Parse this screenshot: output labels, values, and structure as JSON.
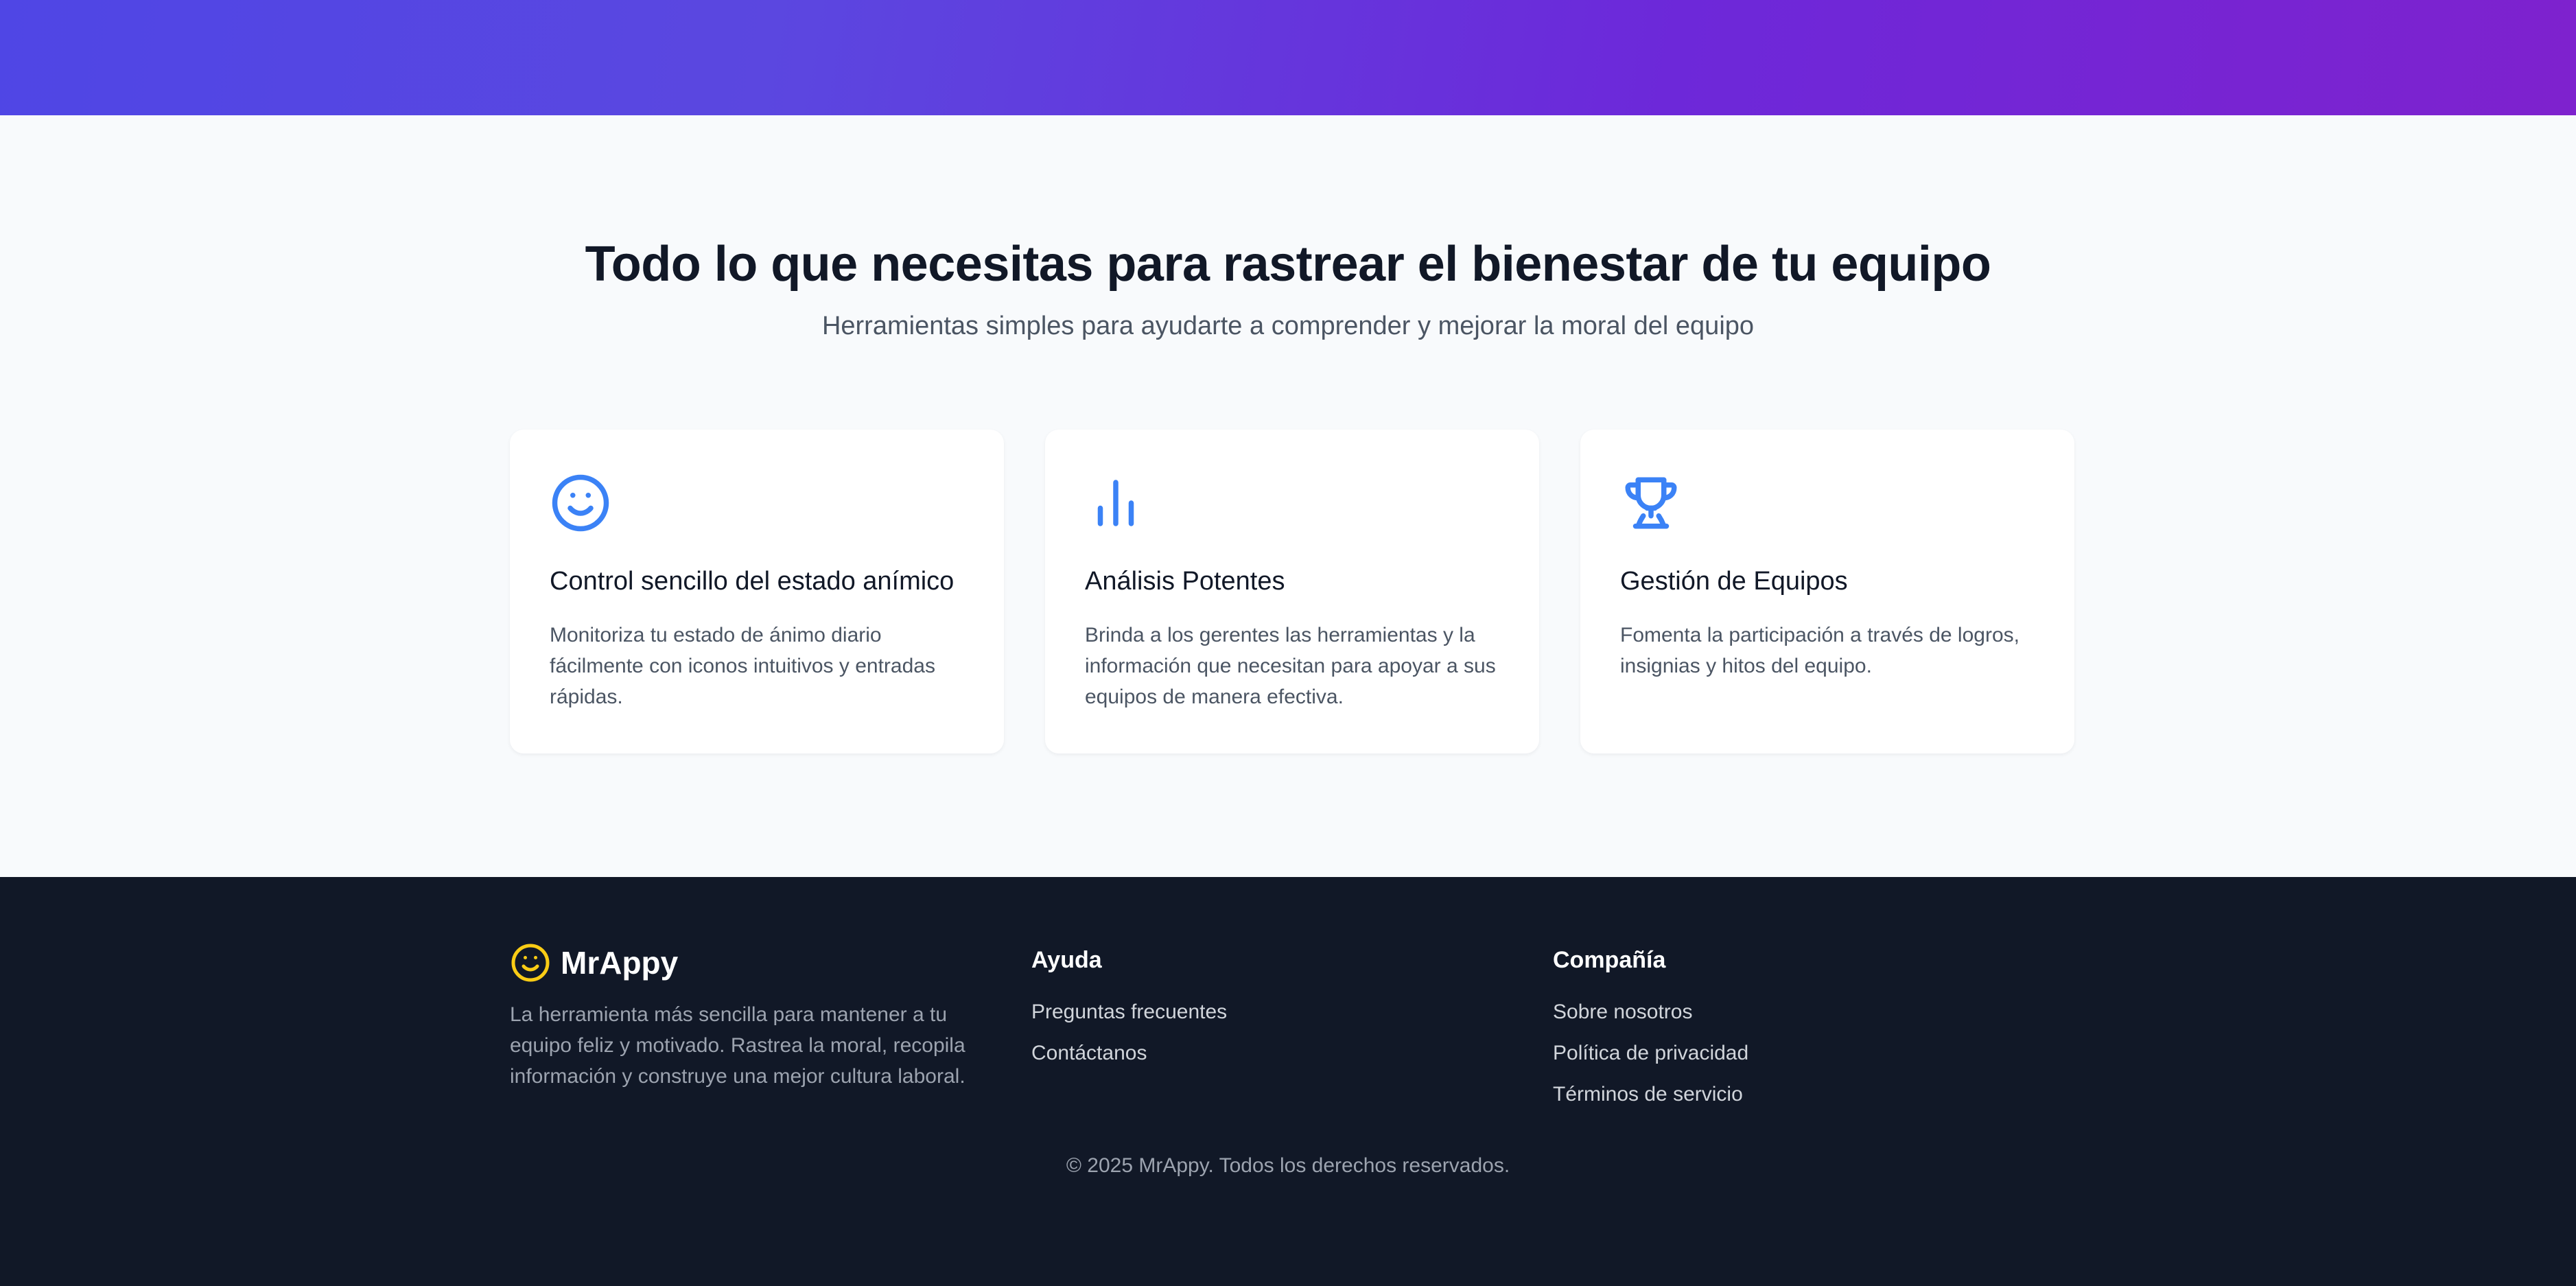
{
  "colors": {
    "accent_blue": "#3b82f6",
    "brand_yellow": "#facc15",
    "hero_gradient_start": "#4f46e5",
    "hero_gradient_end": "#7e22ce",
    "footer_bg": "#111827"
  },
  "features": {
    "title": "Todo lo que necesitas para rastrear el bienestar de tu equipo",
    "subtitle": "Herramientas simples para ayudarte a comprender y mejorar la moral del equipo",
    "cards": [
      {
        "icon": "smile-icon",
        "title": "Control sencillo del estado anímico",
        "description": "Monitoriza tu estado de ánimo diario fácilmente con iconos intuitivos y entradas rápidas."
      },
      {
        "icon": "bar-chart-icon",
        "title": "Análisis Potentes",
        "description": "Brinda a los gerentes las herramientas y la información que necesitan para apoyar a sus equipos de manera efectiva."
      },
      {
        "icon": "trophy-icon",
        "title": "Gestión de Equipos",
        "description": "Fomenta la participación a través de logros, insignias y hitos del equipo."
      }
    ]
  },
  "footer": {
    "brand": {
      "logo_icon": "smile-icon",
      "name": "MrAppy",
      "description": "La herramienta más sencilla para mantener a tu equipo feliz y motivado. Rastrea la moral, recopila información y construye una mejor cultura laboral."
    },
    "help": {
      "heading": "Ayuda",
      "links": [
        "Preguntas frecuentes",
        "Contáctanos"
      ]
    },
    "company": {
      "heading": "Compañía",
      "links": [
        "Sobre nosotros",
        "Política de privacidad",
        "Términos de servicio"
      ]
    },
    "copyright": "© 2025 MrAppy. Todos los derechos reservados."
  }
}
